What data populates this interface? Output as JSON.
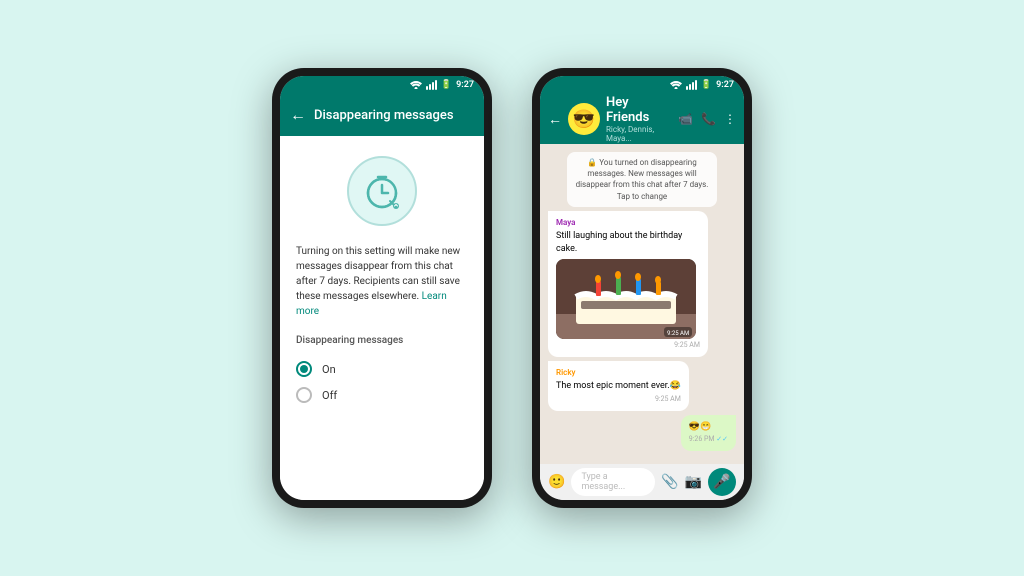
{
  "background_color": "#d8f5f0",
  "phone1": {
    "status_bar": {
      "time": "9:27"
    },
    "header": {
      "back_label": "←",
      "title": "Disappearing messages"
    },
    "description": "Turning on this setting will make new messages disappear from this chat after 7 days. Recipients can still save these messages elsewhere.",
    "learn_more_label": "Learn more",
    "section_title": "Disappearing messages",
    "options": [
      {
        "label": "On",
        "selected": true
      },
      {
        "label": "Off",
        "selected": false
      }
    ]
  },
  "phone2": {
    "status_bar": {
      "time": "9:27"
    },
    "header": {
      "back_label": "←",
      "group_name": "Hey Friends",
      "members": "Ricky, Dennis, Maya...",
      "avatar_emoji": "😎"
    },
    "system_message": "🔒 You turned on disappearing messages. New messages will disappear from this chat after 7 days. Tap to change",
    "messages": [
      {
        "type": "received",
        "sender": "Maya",
        "sender_class": "sender-maya",
        "text": "Still laughing about the birthday cake.",
        "time": "9:25 AM",
        "has_image": true,
        "image_time": "9:25 AM"
      },
      {
        "type": "received",
        "sender": "Ricky",
        "sender_class": "sender-ricky",
        "text": "The most epic moment ever.😂",
        "time": "9:25 AM",
        "has_image": false
      },
      {
        "type": "sent",
        "text": "😎😁",
        "time": "9:26 PM",
        "checkmarks": "✓✓"
      }
    ],
    "input_placeholder": "Type a message..."
  }
}
